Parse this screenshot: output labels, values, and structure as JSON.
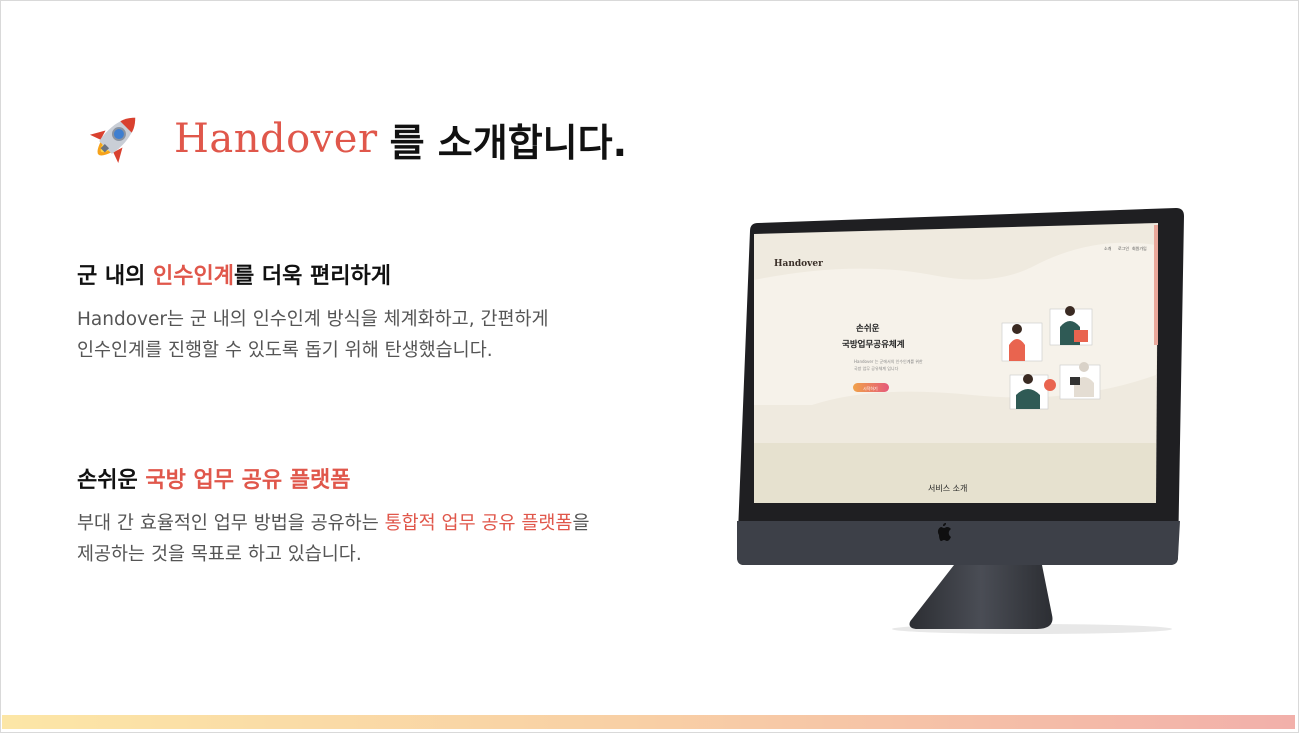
{
  "title": {
    "brand": "Handover",
    "rest": "를 소개합니다."
  },
  "section1": {
    "heading_pre": "군 내의 ",
    "heading_accent": "인수인계",
    "heading_post": "를 더욱 편리하게",
    "body_line1": "Handover는 군 내의 인수인계 방식을 체계화하고, 간편하게",
    "body_line2": "인수인계를 진행할 수 있도록 돕기 위해 탄생했습니다."
  },
  "section2": {
    "heading_pre": "손쉬운 ",
    "heading_accent": "국방 업무 공유 플랫폼",
    "body_line1_pre": "부대 간 효율적인 업무 방법을 공유하는 ",
    "body_line1_accent": "통합적 업무 공유 플랫폼",
    "body_line1_post": "을",
    "body_line2": "제공하는 것을 목표로 하고 있습니다."
  },
  "screen": {
    "logo": "Handover",
    "nav": [
      "소개",
      "로그인",
      "회원가입"
    ],
    "hero_line1": "손쉬운",
    "hero_line2": "국방업무공유체계",
    "hero_desc1": "Handover 는 군에서의 인수인계를 위한",
    "hero_desc2": "국방 업무 공유체계 입니다",
    "hero_button": "시작하기",
    "section_label": "서비스 소개"
  },
  "colors": {
    "accent": "#e0574b",
    "screen_bg": "#efeadf",
    "bezel": "#1f1f22",
    "monitor_body": "#3a3d44"
  },
  "icons": {
    "rocket": "rocket-icon",
    "apple": "apple-logo-icon"
  }
}
